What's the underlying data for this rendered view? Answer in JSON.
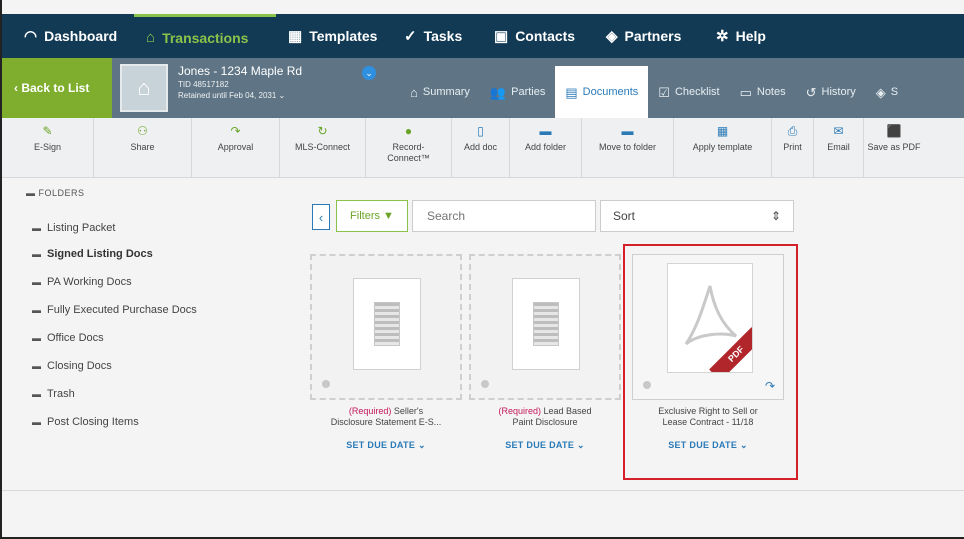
{
  "topnav": {
    "items": [
      {
        "label": "Dashboard",
        "icon": "◠"
      },
      {
        "label": "Transactions",
        "icon": "⌂"
      },
      {
        "label": "Templates",
        "icon": "▦"
      },
      {
        "label": "Tasks",
        "icon": "✓"
      },
      {
        "label": "Contacts",
        "icon": "▣"
      },
      {
        "label": "Partners",
        "icon": "◈"
      },
      {
        "label": "Help",
        "icon": "✲"
      }
    ]
  },
  "subheader": {
    "back_label": "‹ Back to List",
    "title": "Jones - 1234 Maple Rd",
    "tid": "TID 48517182",
    "retained": "Retained until Feb 04, 2031 ⌄",
    "tabs": [
      {
        "label": "Summary",
        "icon": "⌂"
      },
      {
        "label": "Parties",
        "icon": "👥"
      },
      {
        "label": "Documents",
        "icon": "▤"
      },
      {
        "label": "Checklist",
        "icon": "☑"
      },
      {
        "label": "Notes",
        "icon": "▭"
      },
      {
        "label": "History",
        "icon": "↺"
      },
      {
        "label": "S",
        "icon": "◈"
      }
    ]
  },
  "toolbar": {
    "tools": [
      {
        "label": "E-Sign",
        "icon": "✎"
      },
      {
        "label": "Share",
        "icon": "⚇"
      },
      {
        "label": "Approval",
        "icon": "↷"
      },
      {
        "label": "MLS-Connect",
        "icon": "↻"
      },
      {
        "label": "Record-Connect™",
        "icon": "●"
      },
      {
        "label": "Add doc",
        "icon": "▯"
      },
      {
        "label": "Add folder",
        "icon": "▬"
      },
      {
        "label": "Move to folder",
        "icon": "▬"
      },
      {
        "label": "Apply template",
        "icon": "▦"
      },
      {
        "label": "Print",
        "icon": "⎙"
      },
      {
        "label": "Email",
        "icon": "✉"
      },
      {
        "label": "Save as PDF",
        "icon": "⬛"
      }
    ]
  },
  "sidebar": {
    "header": "FOLDERS",
    "folders": [
      "Listing Packet",
      "Signed Listing Docs",
      "PA Working Docs",
      "Fully Executed Purchase Docs",
      "Office Docs",
      "Closing Docs",
      "Trash",
      "Post Closing Items"
    ]
  },
  "controls": {
    "back": "‹",
    "filters": "Filters ▼",
    "search_placeholder": "Search",
    "sort": "Sort",
    "sort_caret": "⇕"
  },
  "documents": [
    {
      "required": "(Required)",
      "name_line1": "Seller's",
      "name_line2": "Disclosure Statement E-S...",
      "due": "SET DUE DATE ⌄"
    },
    {
      "required": "(Required)",
      "name_line1": "Lead Based",
      "name_line2": "Paint Disclosure",
      "due": "SET DUE DATE ⌄"
    },
    {
      "required": "",
      "name_line1": "Exclusive Right to Sell or",
      "name_line2": "Lease Contract - 11/18",
      "due": "SET DUE DATE ⌄",
      "pdf_label": "PDF"
    }
  ]
}
